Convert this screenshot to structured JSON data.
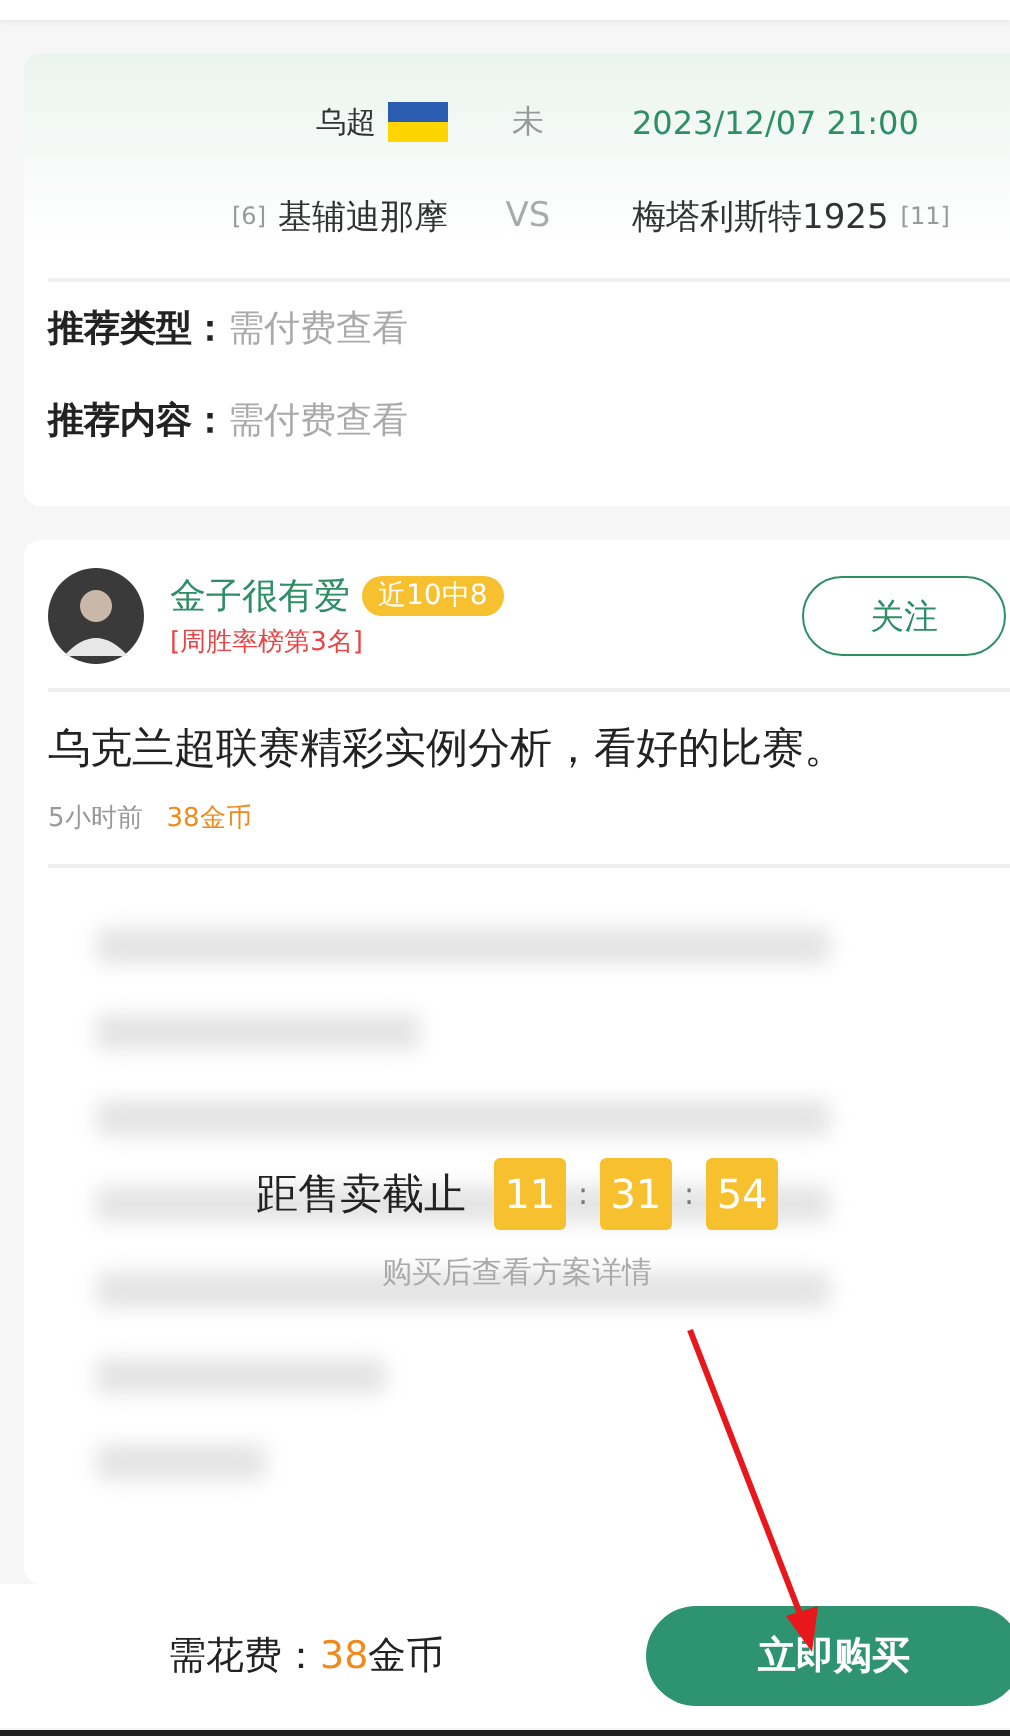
{
  "match": {
    "league": "乌超",
    "status": "未",
    "time": "2023/12/07 21:00",
    "home": {
      "rank": "[6]",
      "name": "基辅迪那摩"
    },
    "vs": "VS",
    "away": {
      "name": "梅塔利斯特1925",
      "rank": "[11]"
    }
  },
  "info_rows": [
    {
      "label": "推荐类型：",
      "value": "需付费查看"
    },
    {
      "label": "推荐内容：",
      "value": "需付费查看"
    }
  ],
  "author": {
    "name": "金子很有爱",
    "badge": "近10中8",
    "rank_title": "[周胜率榜第3名]",
    "follow": "关注"
  },
  "article": {
    "title": "乌克兰超联赛精彩实例分析，看好的比赛。",
    "time": "5小时前",
    "price": "38金币"
  },
  "countdown": {
    "label": "距售卖截止",
    "values": [
      "11",
      "31",
      "54"
    ],
    "separator": ":",
    "hint": "购买后查看方案详情"
  },
  "bottom_bar": {
    "cost_label": "需花费：",
    "cost_amount": "38",
    "cost_unit": "金币",
    "buy": "立即购买"
  }
}
